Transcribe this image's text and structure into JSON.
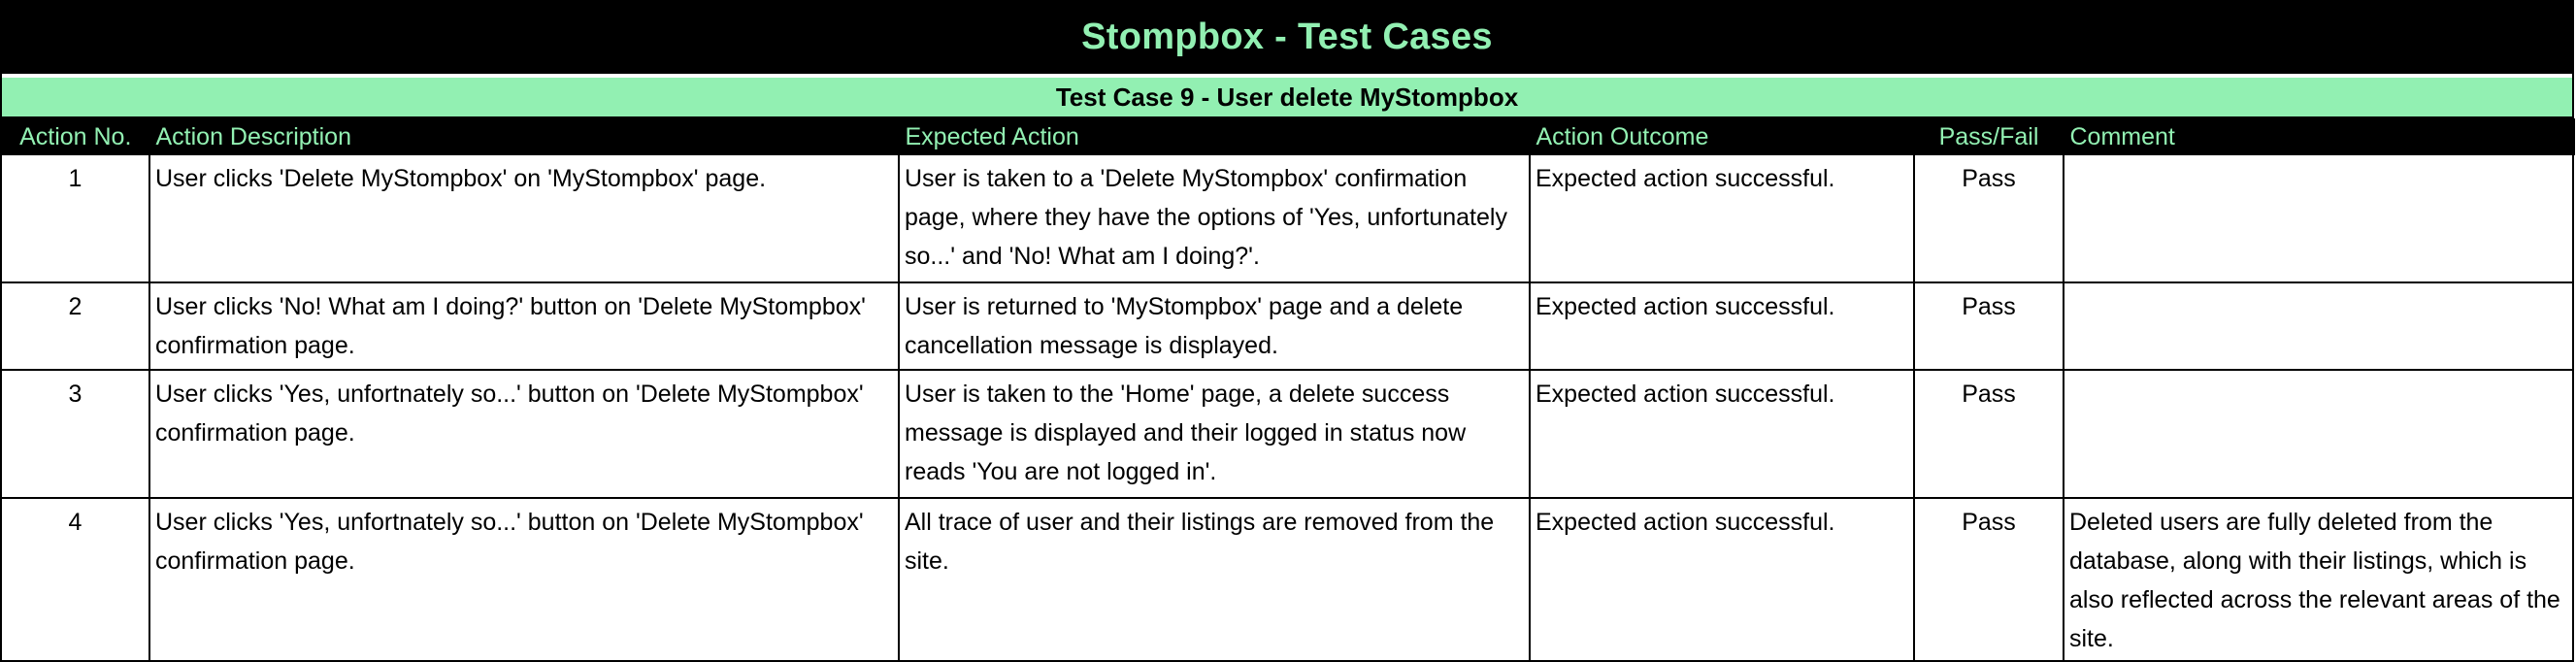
{
  "title": "Stompbox - Test Cases",
  "subtitle": "Test Case 9 - User delete MyStompbox",
  "colors": {
    "accent_green": "#92f0b2",
    "header_black": "#000000"
  },
  "columns": [
    "Action No.",
    "Action Description",
    "Expected Action",
    "Action Outcome",
    "Pass/Fail",
    "Comment"
  ],
  "rows": [
    {
      "no": "1",
      "description": "User clicks 'Delete MyStompbox' on 'MyStompbox' page.",
      "expected": "User is taken to a 'Delete MyStompbox' confirmation page, where they have the options of 'Yes, unfortunately so...' and 'No!  What am I doing?'.",
      "outcome": "Expected action successful.",
      "result": "Pass",
      "comment": ""
    },
    {
      "no": "2",
      "description": "User clicks 'No! What am I doing?' button on 'Delete MyStompbox' confirmation page.",
      "expected": "User is returned to 'MyStompbox' page and a delete cancellation message is displayed.",
      "outcome": "Expected action successful.",
      "result": "Pass",
      "comment": ""
    },
    {
      "no": "3",
      "description": "User clicks 'Yes, unfortnately so...' button on 'Delete MyStompbox' confirmation page.",
      "expected": "User is taken to the 'Home' page, a delete success message is displayed and their logged in status now reads 'You are not logged in'.",
      "outcome": "Expected action successful.",
      "result": "Pass",
      "comment": ""
    },
    {
      "no": "4",
      "description": "User clicks 'Yes, unfortnately so...' button on 'Delete MyStompbox' confirmation page.",
      "expected": "All trace of user and their listings are removed from the site.",
      "outcome": "Expected action successful.",
      "result": "Pass",
      "comment": "Deleted users are fully deleted from the database, along with their listings, which is also reflected across the relevant areas of the site."
    }
  ]
}
